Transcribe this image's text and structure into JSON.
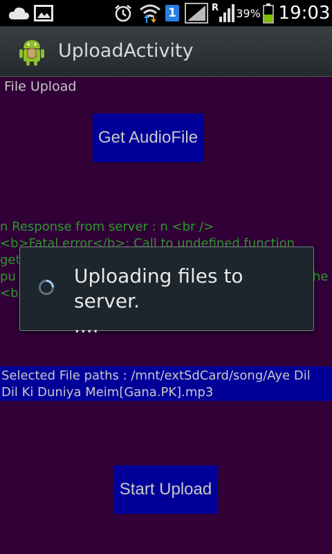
{
  "status_bar": {
    "battery_percent": "39%",
    "time": "19:03",
    "notification_badge": "1",
    "roaming_label": "R",
    "icons": [
      "cloud-icon",
      "image-icon",
      "alarm-icon",
      "wifi-icon",
      "sim-badge-icon",
      "signal-icon",
      "roaming-signal-icon",
      "battery-icon"
    ]
  },
  "action_bar": {
    "title": "UploadActivity",
    "icon": "android-icon"
  },
  "main": {
    "file_upload_label": "File Upload",
    "get_audio_button": "Get AudioFile",
    "response_lines": [
      "n Response from server : n <br />",
      "<b>Fatal error</b>:  Call to undefined function",
      "get",
      "pu",
      "<b"
    ],
    "response_line2_tail": "he",
    "selected_paths": "Selected File paths : /mnt/extSdCard/song/Aye Dil Dil Ki Duniya Meim[Gana.PK].mp3",
    "start_upload_button": "Start Upload"
  },
  "dialog": {
    "message_line1": "Uploading files to server.",
    "message_line2": "...."
  },
  "colors": {
    "background": "#300037",
    "button": "#000099",
    "response_text": "#2a9a2a",
    "battery": "#7cc000"
  }
}
